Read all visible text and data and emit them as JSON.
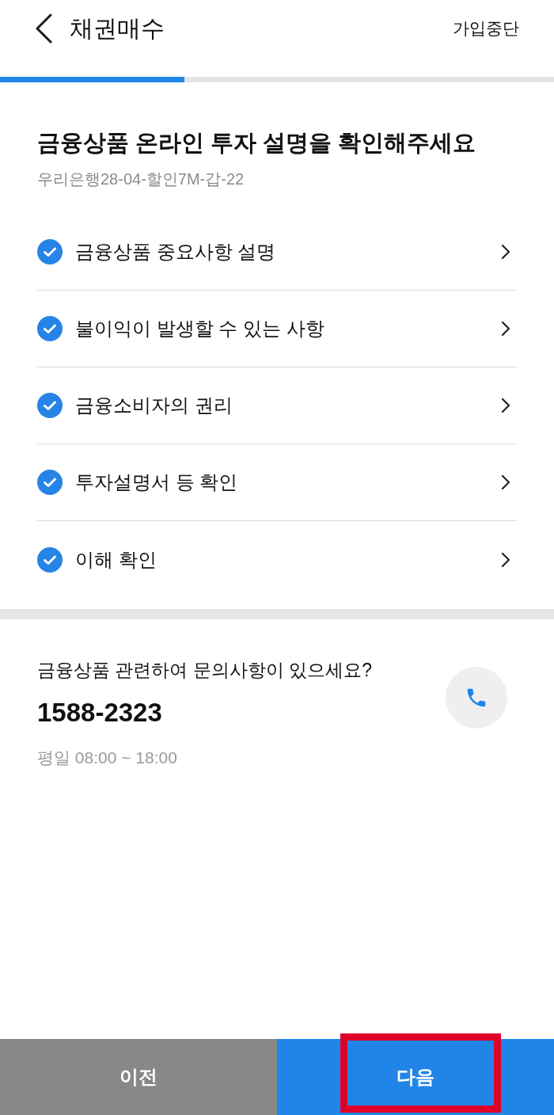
{
  "header": {
    "title": "채권매수",
    "action": "가입중단"
  },
  "progress": {
    "level": 0.333
  },
  "intro": {
    "heading": "금융상품 온라인 투자 설명을 확인해주세요",
    "product": "우리은행28-04-할인7M-갑-22"
  },
  "checklist": [
    {
      "label": "금융상품 중요사항 설명",
      "checked": true
    },
    {
      "label": "불이익이 발생할 수 있는 사항",
      "checked": true
    },
    {
      "label": "금융소비자의 권리",
      "checked": true
    },
    {
      "label": "투자설명서 등 확인",
      "checked": true
    },
    {
      "label": "이해 확인",
      "checked": true
    }
  ],
  "contact": {
    "question": "금융상품 관련하여 문의사항이 있으세요?",
    "phone": "1588-2323",
    "hours": "평일 08:00 ~ 18:00"
  },
  "footer_buttons": [
    {
      "label": "이전",
      "kind": "secondary",
      "highlighted": false
    },
    {
      "label": "다음",
      "kind": "primary",
      "highlighted": true
    }
  ]
}
